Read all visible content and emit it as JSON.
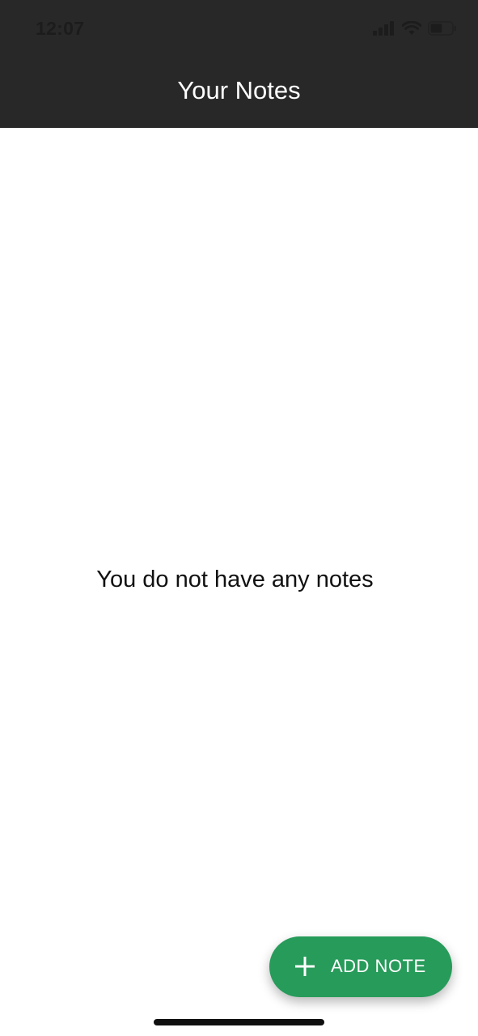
{
  "status_bar": {
    "time": "12:07",
    "icons": [
      "signal-icon",
      "wifi-icon",
      "battery-icon"
    ],
    "battery_level": 0.55
  },
  "header": {
    "title": "Your Notes",
    "background": "#282828"
  },
  "main": {
    "empty_message": "You do not have any notes"
  },
  "fab": {
    "icon": "plus-icon",
    "label": "ADD NOTE",
    "color": "#279b5a"
  }
}
